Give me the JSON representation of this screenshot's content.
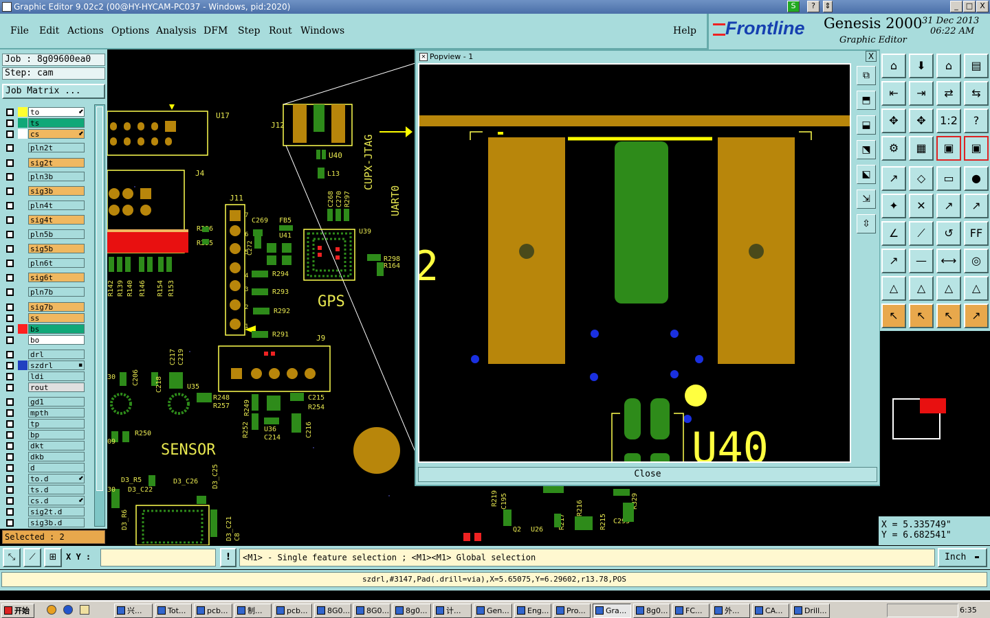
{
  "window": {
    "title": "Graphic Editor 9.02c2 (00@HY-HYCAM-PC037 - Windows, pid:2020)",
    "minimize": "_",
    "maximize": "□",
    "close": "X",
    "help_glyph": "?",
    "s_glyph": "S",
    "scroll_glyph": "⇕"
  },
  "menu": {
    "items": [
      "File",
      "Edit",
      "Actions",
      "Options",
      "Analysis",
      "DFM",
      "Step",
      "Rout",
      "Windows"
    ],
    "help": "Help"
  },
  "brand": {
    "logo": "Frontline",
    "product": "Genesis 2000",
    "subtitle": "Graphic Editor",
    "date": "31 Dec 2013",
    "time": "06:22 AM"
  },
  "job": {
    "job_line": "Job : 8g09600ea0",
    "step_line": "Step: cam",
    "matrix_button": "Job Matrix ..."
  },
  "layers": [
    {
      "name": "to",
      "swatch": "#ffff30",
      "bg": "#ffffff",
      "marker": "⬋"
    },
    {
      "name": "ts",
      "swatch": "#10a878",
      "bg": "#10a878",
      "marker": ""
    },
    {
      "name": "cs",
      "swatch": "#ffffff",
      "bg": "#f0b860",
      "marker": "⬋"
    },
    {
      "name": "pln2t",
      "swatch": "",
      "bg": "#a8dcdc",
      "marker": ""
    },
    {
      "name": "sig2t",
      "swatch": "",
      "bg": "#f0b860",
      "marker": ""
    },
    {
      "name": "pln3b",
      "swatch": "",
      "bg": "#a8dcdc",
      "marker": ""
    },
    {
      "name": "sig3b",
      "swatch": "",
      "bg": "#f0b860",
      "marker": ""
    },
    {
      "name": "pln4t",
      "swatch": "",
      "bg": "#a8dcdc",
      "marker": ""
    },
    {
      "name": "sig4t",
      "swatch": "",
      "bg": "#f0b860",
      "marker": ""
    },
    {
      "name": "pln5b",
      "swatch": "",
      "bg": "#a8dcdc",
      "marker": ""
    },
    {
      "name": "sig5b",
      "swatch": "",
      "bg": "#f0b860",
      "marker": ""
    },
    {
      "name": "pln6t",
      "swatch": "",
      "bg": "#a8dcdc",
      "marker": ""
    },
    {
      "name": "sig6t",
      "swatch": "",
      "bg": "#f0b860",
      "marker": ""
    },
    {
      "name": "pln7b",
      "swatch": "",
      "bg": "#a8dcdc",
      "marker": ""
    },
    {
      "name": "sig7b",
      "swatch": "",
      "bg": "#f0b860",
      "marker": ""
    },
    {
      "name": "ss",
      "swatch": "",
      "bg": "#f0b860",
      "marker": ""
    },
    {
      "name": "bs",
      "swatch": "#ff2020",
      "bg": "#10a878",
      "marker": ""
    },
    {
      "name": "bo",
      "swatch": "",
      "bg": "#ffffff",
      "marker": ""
    },
    {
      "name": "drl",
      "swatch": "",
      "bg": "#a8dcdc",
      "marker": ""
    },
    {
      "name": "szdrl",
      "swatch": "#2040c0",
      "bg": "#a8dcdc",
      "marker": "▪"
    },
    {
      "name": "ldi",
      "swatch": "",
      "bg": "#a8dcdc",
      "marker": ""
    },
    {
      "name": "rout",
      "swatch": "",
      "bg": "#e0e0e0",
      "marker": ""
    },
    {
      "name": "gd1",
      "swatch": "",
      "bg": "#a8dcdc",
      "marker": ""
    },
    {
      "name": "mpth",
      "swatch": "",
      "bg": "#a8dcdc",
      "marker": ""
    },
    {
      "name": "tp",
      "swatch": "",
      "bg": "#a8dcdc",
      "marker": ""
    },
    {
      "name": "bp",
      "swatch": "",
      "bg": "#a8dcdc",
      "marker": ""
    },
    {
      "name": "dkt",
      "swatch": "",
      "bg": "#a8dcdc",
      "marker": ""
    },
    {
      "name": "dkb",
      "swatch": "",
      "bg": "#a8dcdc",
      "marker": ""
    },
    {
      "name": "d",
      "swatch": "",
      "bg": "#a8dcdc",
      "marker": ""
    },
    {
      "name": "to.d",
      "swatch": "",
      "bg": "#a8dcdc",
      "marker": "⬋"
    },
    {
      "name": "ts.d",
      "swatch": "",
      "bg": "#a8dcdc",
      "marker": ""
    },
    {
      "name": "cs.d",
      "swatch": "",
      "bg": "#a8dcdc",
      "marker": "⬋"
    },
    {
      "name": "sig2t.d",
      "swatch": "",
      "bg": "#a8dcdc",
      "marker": ""
    },
    {
      "name": "sig3b.d",
      "swatch": "",
      "bg": "#a8dcdc",
      "marker": ""
    }
  ],
  "selected": "Selected : 2",
  "popup": {
    "title": "Popview - 1",
    "close_label": "Close",
    "close_x": "X",
    "label_u40": "U40",
    "label_2": "2"
  },
  "canvas_labels": {
    "u17": "U17",
    "j12": "J12",
    "j4": "J4",
    "j11": "J11",
    "u40": "U40",
    "l13": "L13",
    "c268": "C268",
    "c270": "C270",
    "r297": "R297",
    "cupx": "CUPX-JTAG",
    "uart0": "UART0",
    "c269": "C269",
    "fb5": "FB5",
    "u41": "U41",
    "u39": "U39",
    "r296": "R296",
    "r295": "R295",
    "c272": "C272",
    "r298": "R298",
    "r164": "R164",
    "r294": "R294",
    "r293": "R293",
    "r292": "R292",
    "r291": "R291",
    "gps": "GPS",
    "j9": "J9",
    "r142": "R142",
    "r139": "R139",
    "r140": "R140",
    "r146": "R146",
    "r154": "R154",
    "r153": "R153",
    "c206": "C206",
    "c218": "C218",
    "c217": "C217",
    "c219": "C219",
    "u35": "U35",
    "r248": "R248",
    "r257": "R257",
    "r249": "R249",
    "r252": "R252",
    "c215": "C215",
    "r254": "R254",
    "u36": "U36",
    "c214": "C214",
    "c216": "C216",
    "r250": "R250",
    "sensor": "SENSOR",
    "d3r5": "D3_R5",
    "d3c26": "D3_C26",
    "d3c22": "D3_C22",
    "d3c25": "D3_C25",
    "d3r6": "D3_R6",
    "d3c21": "D3_C21",
    "c8": "C8",
    "u26": "U26",
    "r217": "R217",
    "r216": "R216",
    "r215": "R215",
    "r219": "R219",
    "c195": "C195",
    "c295": "C295",
    "r329": "R329",
    "q2": "Q2",
    "pin7": "7",
    "pin6": "6",
    "pin5": "5",
    "pin4": "4",
    "pin3": "3",
    "pin2": "2",
    "pin1": "1",
    "c30": "30",
    "c09": "09",
    "c30b": "30"
  },
  "coords": {
    "x": "X = 5.335749\"",
    "y": "Y = 6.682541\""
  },
  "command": {
    "xy_label": "X Y :",
    "xy_value": "",
    "warn": "!",
    "prompt": "<M1> - Single feature selection ; <M1><M1> Global selection",
    "units": "Inch"
  },
  "status_message": "szdrl,#3147,Pad(.drill=via),X=5.65075,Y=6.29602,r13.78,POS",
  "tools": {
    "popup_tools": [
      "⧉",
      "⬒",
      "⬓",
      "⬔",
      "⬕",
      "⇲",
      "⇳"
    ],
    "grid": [
      "⌂",
      "⬇",
      "⌂",
      "▤",
      "⇤",
      "⇥",
      "⇄",
      "⇆",
      "✥",
      "✥",
      "1:2",
      "?",
      "⚙",
      "▦",
      "▣",
      "▣",
      "↗",
      "◇",
      "▭",
      "●",
      "✦",
      "✕",
      "↗",
      "↗",
      "∠",
      "⟋",
      "↺",
      "FF",
      "↗",
      "—",
      "⟷",
      "◎",
      "△",
      "△",
      "△",
      "△",
      "↖",
      "↖",
      "↖",
      "↗"
    ]
  },
  "taskbar": {
    "start": "开始",
    "items": [
      "兴...",
      "Tot...",
      "pcb...",
      "制...",
      "pcb...",
      "8G0...",
      "8G0...",
      "8g0...",
      "计...",
      "Gen...",
      "Eng...",
      "Pro...",
      "Gra...",
      "8g0...",
      "FC...",
      "外...",
      "CA...",
      "Drill..."
    ],
    "active_index": 12,
    "clock": "6:35"
  }
}
